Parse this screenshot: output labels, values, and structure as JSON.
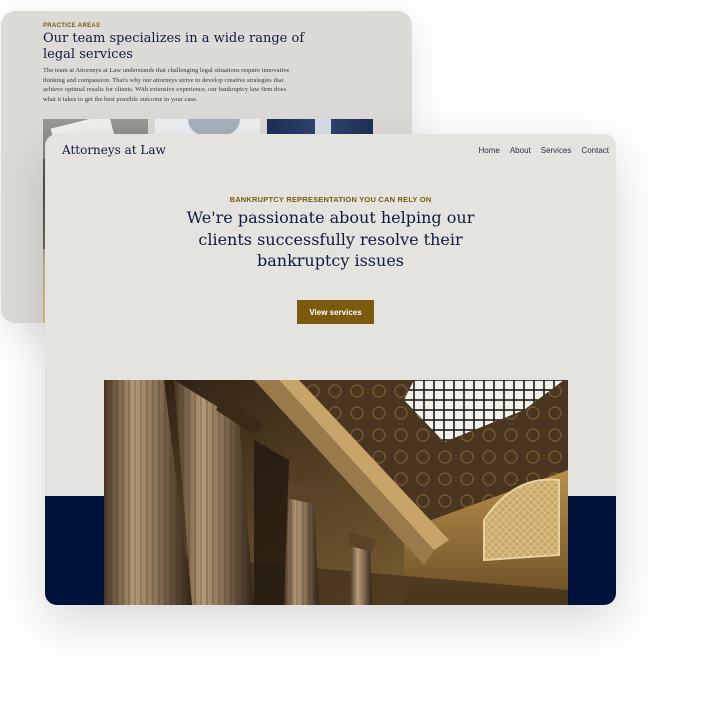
{
  "back_card": {
    "eyebrow": "PRACTICE AREAS",
    "heading": "Our team specializes in a wide range of legal services",
    "body": "The team at Attorneys at Law understands that challenging legal situations require innovative thinking and compassion. That's why our attorneys strive to develop creative strategies that achieve optimal results for clients. With extensive experience, our bankruptcy law firm does what it takes to get the best possible outcome in your case."
  },
  "front_card": {
    "logo": "Attorneys at Law",
    "nav": [
      "Home",
      "About",
      "Services",
      "Contact"
    ],
    "eyebrow": "BANKRUPTCY REPRESENTATION YOU CAN RELY ON",
    "title": "We're passionate about helping our clients successfully resolve their bankruptcy issues",
    "cta_label": "View services"
  },
  "colors": {
    "accent_gold": "#7a5a0c",
    "navy": "#01123a",
    "card_bg": "#e5e3e0",
    "heading_text": "#0f1a3c"
  }
}
